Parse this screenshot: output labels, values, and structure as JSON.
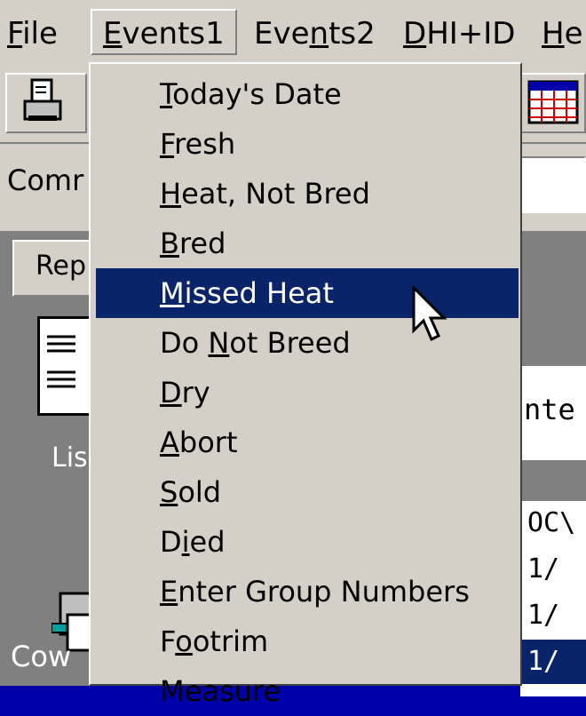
{
  "menubar": {
    "items": [
      {
        "pre": "",
        "acc": "F",
        "post": "ile"
      },
      {
        "pre": "",
        "acc": "E",
        "post": "vents1"
      },
      {
        "pre": "Eve",
        "acc": "n",
        "post": "ts2"
      },
      {
        "pre": "",
        "acc": "D",
        "post": "HI+ID"
      },
      {
        "pre": "",
        "acc": "H",
        "post": "e"
      }
    ]
  },
  "command": {
    "label": "Comr"
  },
  "panel": {
    "tab_label": "Rep",
    "list_label": "Lis",
    "cow_label": "Cow",
    "enter_label": "nte",
    "dc_cells": [
      "OC\\",
      "1/",
      "1/",
      "1/"
    ]
  },
  "dropdown": {
    "items": [
      {
        "pre": "",
        "acc": "T",
        "post": "oday's Date"
      },
      {
        "pre": "",
        "acc": "F",
        "post": "resh"
      },
      {
        "pre": "",
        "acc": "H",
        "post": "eat, Not Bred"
      },
      {
        "pre": "",
        "acc": "B",
        "post": "red"
      },
      {
        "pre": "",
        "acc": "M",
        "post": "issed Heat"
      },
      {
        "pre": "Do ",
        "acc": "N",
        "post": "ot Breed"
      },
      {
        "pre": "",
        "acc": "D",
        "post": "ry"
      },
      {
        "pre": "",
        "acc": "A",
        "post": "bort"
      },
      {
        "pre": "",
        "acc": "S",
        "post": "old"
      },
      {
        "pre": "D",
        "acc": "i",
        "post": "ed"
      },
      {
        "pre": "",
        "acc": "E",
        "post": "nter Group Numbers"
      },
      {
        "pre": "F",
        "acc": "o",
        "post": "otrim"
      },
      {
        "pre": "",
        "acc": "",
        "post": "Measure"
      }
    ],
    "highlighted_index": 4
  },
  "colors": {
    "desktop": "#0000a8",
    "highlight": "#0a246a",
    "face": "#d4d0c8"
  }
}
